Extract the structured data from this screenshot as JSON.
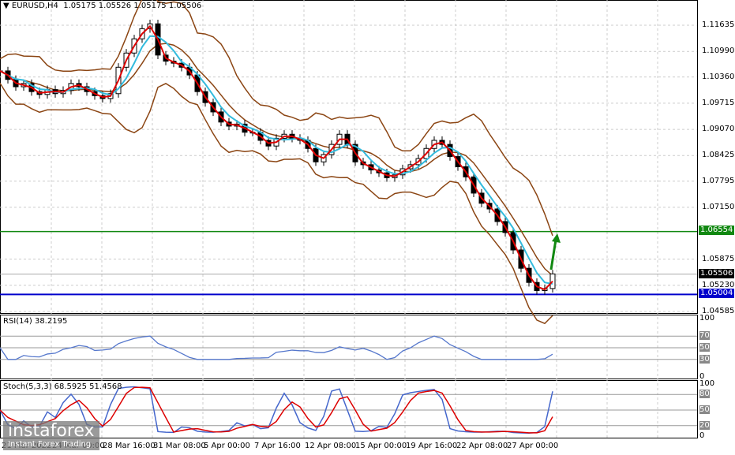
{
  "header": {
    "symbol": "EURUSD,H4",
    "ohlc": "1.05175 1.05526 1.05175 1.05506"
  },
  "rsi": {
    "label": "RSI(14) 38.2195",
    "levels": [
      "100",
      "70",
      "50",
      "30",
      "0"
    ]
  },
  "stoch": {
    "label": "Stoch(5,3,3) 68.5925 51.4568",
    "levels": [
      "100",
      "80",
      "50",
      "20",
      "0"
    ]
  },
  "price_axis": [
    "1.11635",
    "1.10990",
    "1.10360",
    "1.09715",
    "1.09070",
    "1.08425",
    "1.07795",
    "1.07150",
    "1.05875",
    "1.05230",
    "1.04585"
  ],
  "price_tags": {
    "green": "1.06554",
    "current": "1.05506",
    "blue": "1.05004"
  },
  "time_axis": [
    "21 Mar 2022",
    "24 Mar 00:00",
    "28 Mar 16:00",
    "31 Mar 08:00",
    "5 Apr 00:00",
    "7 Apr 16:00",
    "12 Apr 08:00",
    "15 Apr 00:00",
    "19 Apr 16:00",
    "22 Apr 08:00",
    "27 Apr 00:00"
  ],
  "watermark": {
    "brand": "instaforex",
    "tagline": "Instant Forex Trading"
  },
  "colors": {
    "green_line": "#118811",
    "blue_line": "#0000cc",
    "bollinger": "#8b4513",
    "ma_fast": "#dd0000",
    "ma_slow": "#33bbdd",
    "rsi": "#5577cc",
    "stoch_main": "#4466cc",
    "stoch_signal": "#dd0000"
  },
  "chart_data": {
    "type": "candlestick",
    "symbol": "EURUSD",
    "timeframe": "H4",
    "ylim": [
      1.04585,
      1.11635
    ],
    "close": [
      1.1051,
      1.103,
      1.1012,
      1.102,
      1.1,
      1.0993,
      1.1005,
      1.0995,
      1.1003,
      1.102,
      1.1012,
      1.1,
      1.099,
      1.0983,
      1.0995,
      1.106,
      1.1095,
      1.113,
      1.1155,
      1.1167,
      1.109,
      1.1075,
      1.107,
      1.106,
      1.1041,
      1.1,
      1.0973,
      1.095,
      1.0925,
      1.0915,
      1.092,
      1.09,
      1.09,
      1.088,
      1.0866,
      1.0885,
      1.0895,
      1.0885,
      1.088,
      1.086,
      1.0827,
      1.0845,
      1.087,
      1.0895,
      1.087,
      1.0827,
      1.082,
      1.0807,
      1.08,
      1.0788,
      1.0795,
      1.081,
      1.082,
      1.0835,
      1.086,
      1.088,
      1.087,
      1.084,
      1.0815,
      1.079,
      1.075,
      1.0725,
      1.0711,
      1.068,
      1.0653,
      1.061,
      1.0565,
      1.053,
      1.051,
      1.0515,
      1.0551
    ],
    "hlines": [
      1.06554,
      1.05506,
      1.05004
    ]
  }
}
